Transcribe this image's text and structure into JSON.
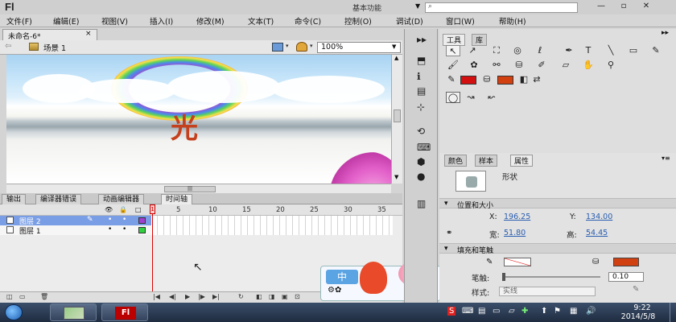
{
  "title_bar": {
    "logo": "Fl",
    "workspace": "基本功能",
    "search_placeholder": ""
  },
  "window_controls": {
    "minimize": "—",
    "restore": "▫",
    "close": "✕"
  },
  "menu": [
    "文件(F)",
    "编辑(E)",
    "视图(V)",
    "插入(I)",
    "修改(M)",
    "文本(T)",
    "命令(C)",
    "控制(O)",
    "调试(D)",
    "窗口(W)",
    "帮助(H)"
  ],
  "document": {
    "tab_label": "未命名-6*",
    "tab_close": "×",
    "scene_label": "场景 1",
    "zoom": "100%"
  },
  "stage": {
    "text": "光"
  },
  "panel_tabs": [
    "输出",
    "编译器错误",
    "动画编辑器",
    "时间轴"
  ],
  "panel_tabs_active": 3,
  "timeline": {
    "frame_numbers": [
      "1",
      "5",
      "10",
      "15",
      "20",
      "25",
      "30",
      "35"
    ],
    "layers": [
      {
        "name": "图层 2",
        "color": "#a040d0",
        "selected": true
      },
      {
        "name": "图层 1",
        "color": "#30d040",
        "selected": false
      }
    ]
  },
  "tools_panel": {
    "tabs": [
      "工具",
      "库"
    ],
    "stroke_color": "#d21010",
    "fill_color": "#d24010"
  },
  "properties": {
    "tabs": [
      "颜色",
      "样本",
      "属性"
    ],
    "active_tab": 2,
    "object_type": "形状",
    "position_section": "位置和大小",
    "x_label": "X:",
    "x_value": "196.25",
    "y_label": "Y:",
    "y_value": "134.00",
    "w_label": "宽:",
    "w_value": "51.80",
    "h_label": "高:",
    "h_value": "54.45",
    "fill_section": "填充和笔触",
    "fill_color": "#d04010",
    "stroke_label": "笔触:",
    "stroke_value": "0.10",
    "style_label": "样式:",
    "style_value": "实线"
  },
  "widget": {
    "lang": "中"
  },
  "taskbar": {
    "clock_time": "9:22",
    "clock_date": "2014/5/8"
  }
}
